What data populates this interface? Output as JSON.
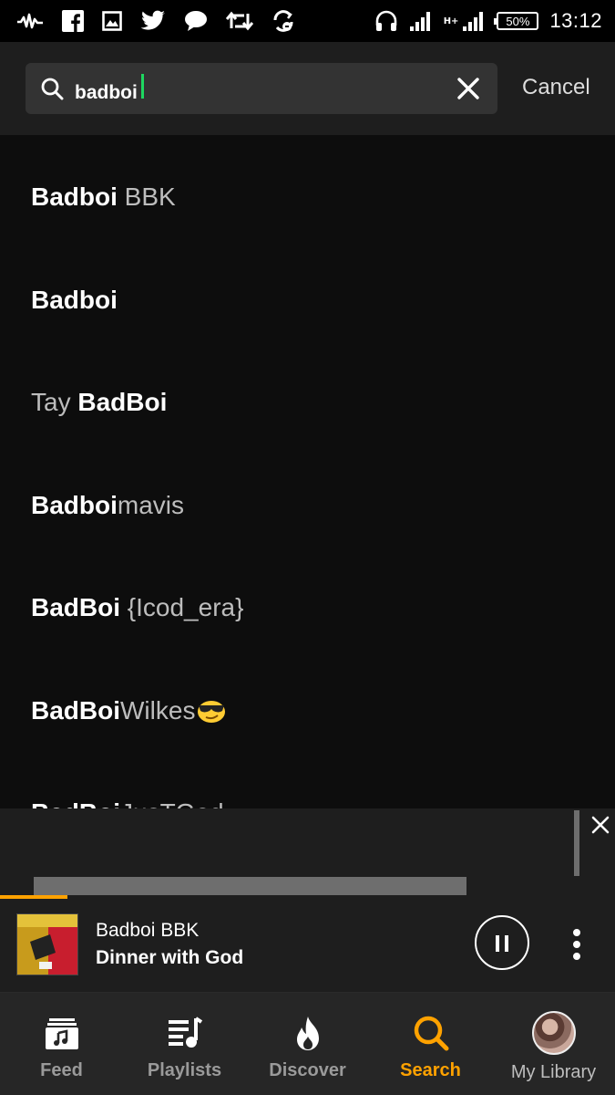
{
  "status_bar": {
    "left_icons": [
      "audiomack-icon",
      "facebook-icon",
      "image-icon",
      "twitter-icon",
      "chat-icon",
      "retweet-icon",
      "sync-icon"
    ],
    "network_label": "H+",
    "battery": "50%",
    "time": "13:12"
  },
  "search": {
    "query": "badboi",
    "cancel_label": "Cancel"
  },
  "results": [
    {
      "bold": "Badboi",
      "rest": " BBK",
      "prefix": ""
    },
    {
      "bold": "Badboi",
      "rest": "",
      "prefix": ""
    },
    {
      "prefix": "Tay ",
      "bold": "BadBoi",
      "rest": ""
    },
    {
      "bold": "Badboi",
      "rest": "mavis",
      "prefix": ""
    },
    {
      "bold": "BadBoi",
      "rest": " {Icod_era}",
      "prefix": ""
    },
    {
      "bold": "BadBoi",
      "rest": "Wilkes",
      "prefix": "",
      "emoji": "cool-face-emoji"
    },
    {
      "bold": "BadBoi",
      "rest": "JusTGod",
      "prefix": ""
    }
  ],
  "player": {
    "artist": "Badboi BBK",
    "title": "Dinner with God",
    "progress_fraction": 0.11
  },
  "nav": {
    "feed": "Feed",
    "playlists": "Playlists",
    "discover": "Discover",
    "search": "Search",
    "library": "My Library",
    "active": "search"
  },
  "colors": {
    "accent": "#ffa200",
    "caret": "#1ed760",
    "background": "#0d0d0d",
    "header": "#1e1e1e"
  }
}
